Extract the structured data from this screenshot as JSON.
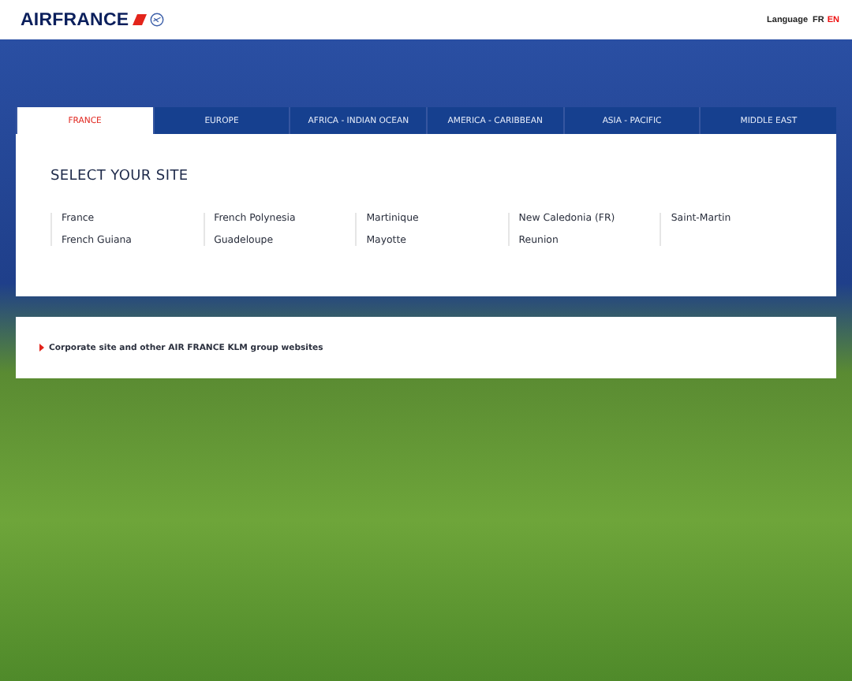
{
  "header": {
    "logo_text": "AIRFRANCE",
    "language_label": "Language",
    "languages": [
      {
        "label": "FR",
        "selected": false
      },
      {
        "label": "EN",
        "selected": true
      }
    ]
  },
  "tabs": [
    {
      "label": "FRANCE",
      "selected": true
    },
    {
      "label": "EUROPE",
      "selected": false
    },
    {
      "label": "AFRICA - INDIAN OCEAN",
      "selected": false
    },
    {
      "label": "AMERICA - CARIBBEAN",
      "selected": false
    },
    {
      "label": "ASIA - PACIFIC",
      "selected": false
    },
    {
      "label": "MIDDLE EAST",
      "selected": false
    }
  ],
  "panel": {
    "title": "SELECT YOUR SITE",
    "site_columns": [
      [
        "France",
        "French Guiana"
      ],
      [
        "French Polynesia",
        "Guadeloupe"
      ],
      [
        "Martinique",
        "Mayotte"
      ],
      [
        "New Caledonia (FR)",
        "Reunion"
      ],
      [
        "Saint-Martin"
      ]
    ]
  },
  "corporate_link": "Corporate site and other AIR FRANCE KLM group websites"
}
